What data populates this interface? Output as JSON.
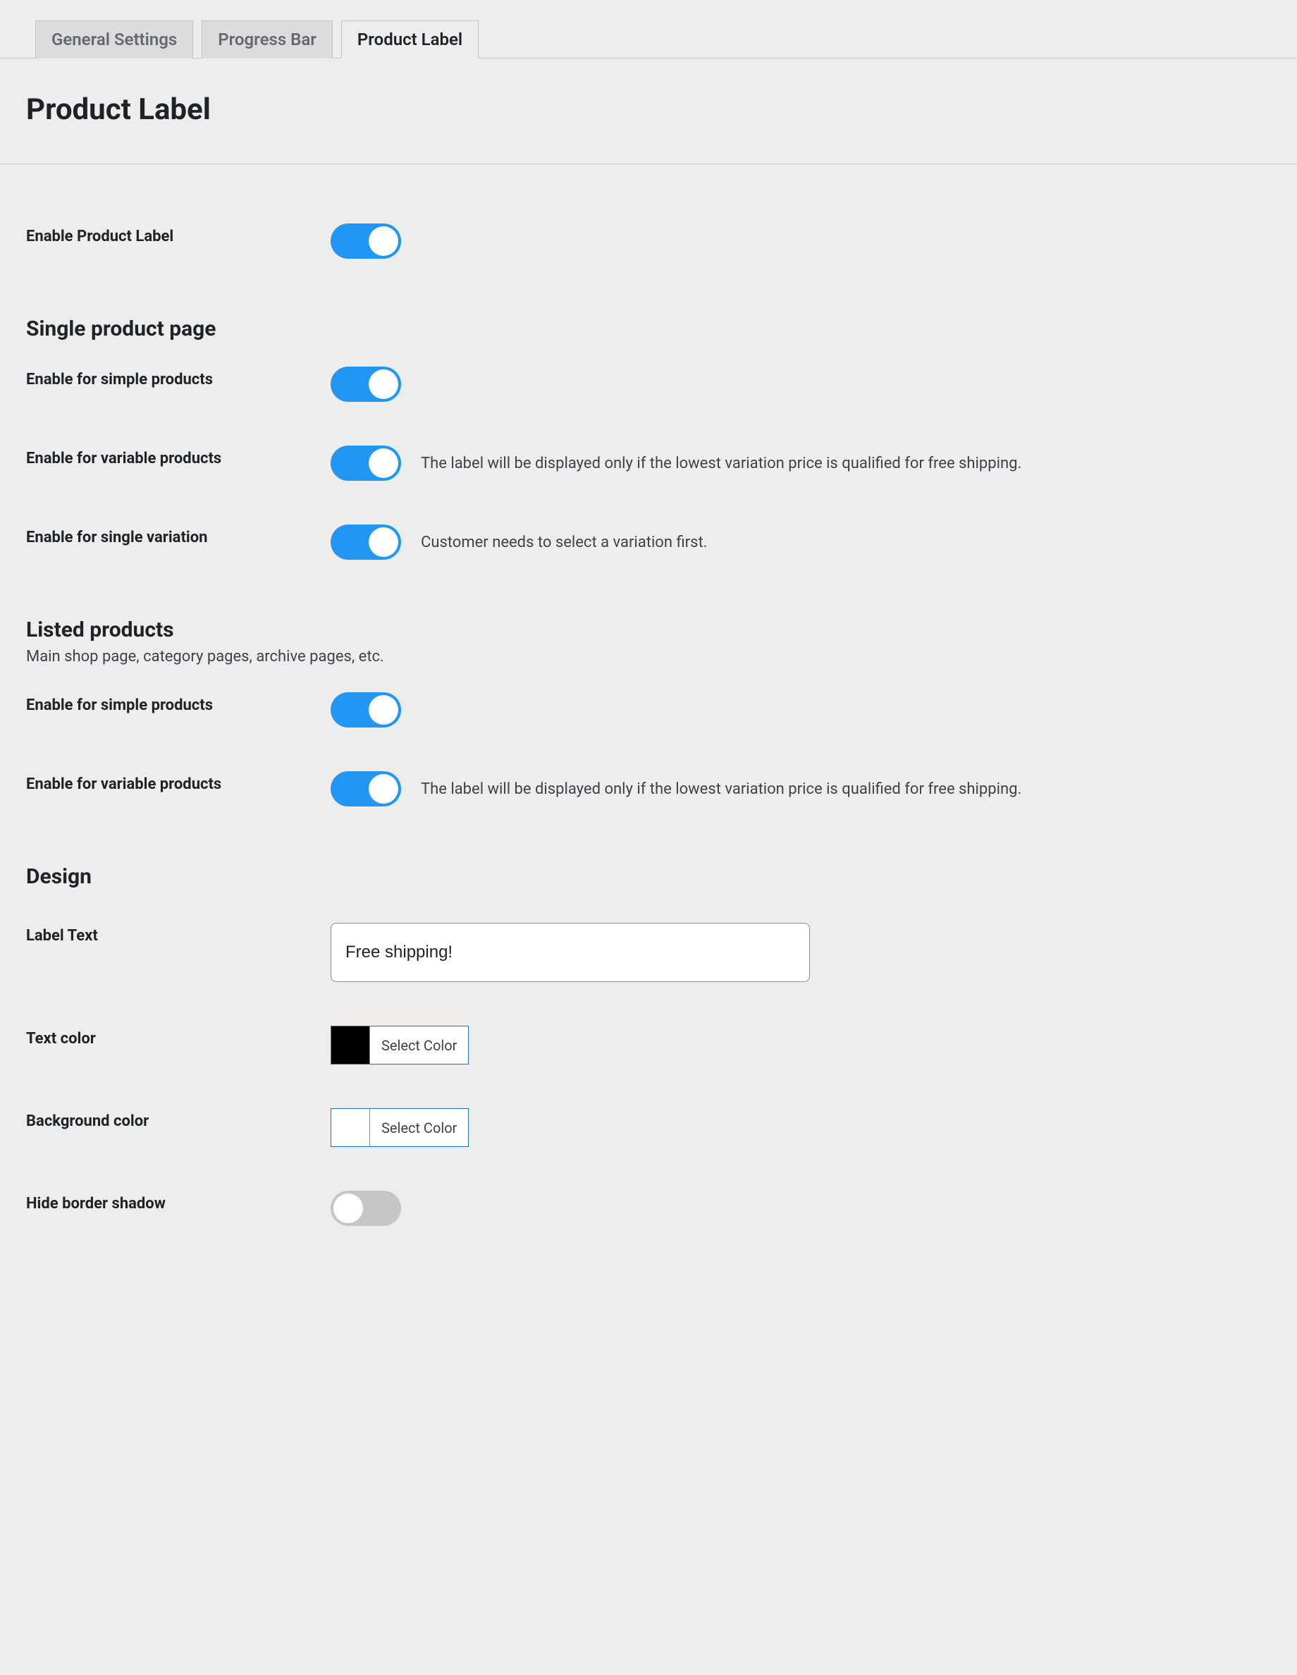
{
  "tabs": [
    {
      "label": "General Settings",
      "active": false
    },
    {
      "label": "Progress Bar",
      "active": false
    },
    {
      "label": "Product Label",
      "active": true
    }
  ],
  "page_title": "Product Label",
  "enable_product_label": {
    "label": "Enable Product Label",
    "on": true
  },
  "section_single": {
    "title": "Single product page"
  },
  "single_simple": {
    "label": "Enable for simple products",
    "on": true
  },
  "single_variable": {
    "label": "Enable for variable products",
    "on": true,
    "desc": "The label will be displayed only if the lowest variation price is qualified for free shipping."
  },
  "single_variation": {
    "label": "Enable for single variation",
    "on": true,
    "desc": "Customer needs to select a variation first."
  },
  "section_listed": {
    "title": "Listed products",
    "sub": "Main shop page, category pages, archive pages, etc."
  },
  "listed_simple": {
    "label": "Enable for simple products",
    "on": true
  },
  "listed_variable": {
    "label": "Enable for variable products",
    "on": true,
    "desc": "The label will be displayed only if the lowest variation price is qualified for free shipping."
  },
  "section_design": {
    "title": "Design"
  },
  "design_text": {
    "label": "Label Text",
    "value": "Free shipping!"
  },
  "design_text_color": {
    "label": "Text color",
    "button": "Select Color",
    "swatch": "#000000"
  },
  "design_bg_color": {
    "label": "Background color",
    "button": "Select Color",
    "swatch": "#ffffff"
  },
  "design_hide_shadow": {
    "label": "Hide border shadow",
    "on": false
  }
}
